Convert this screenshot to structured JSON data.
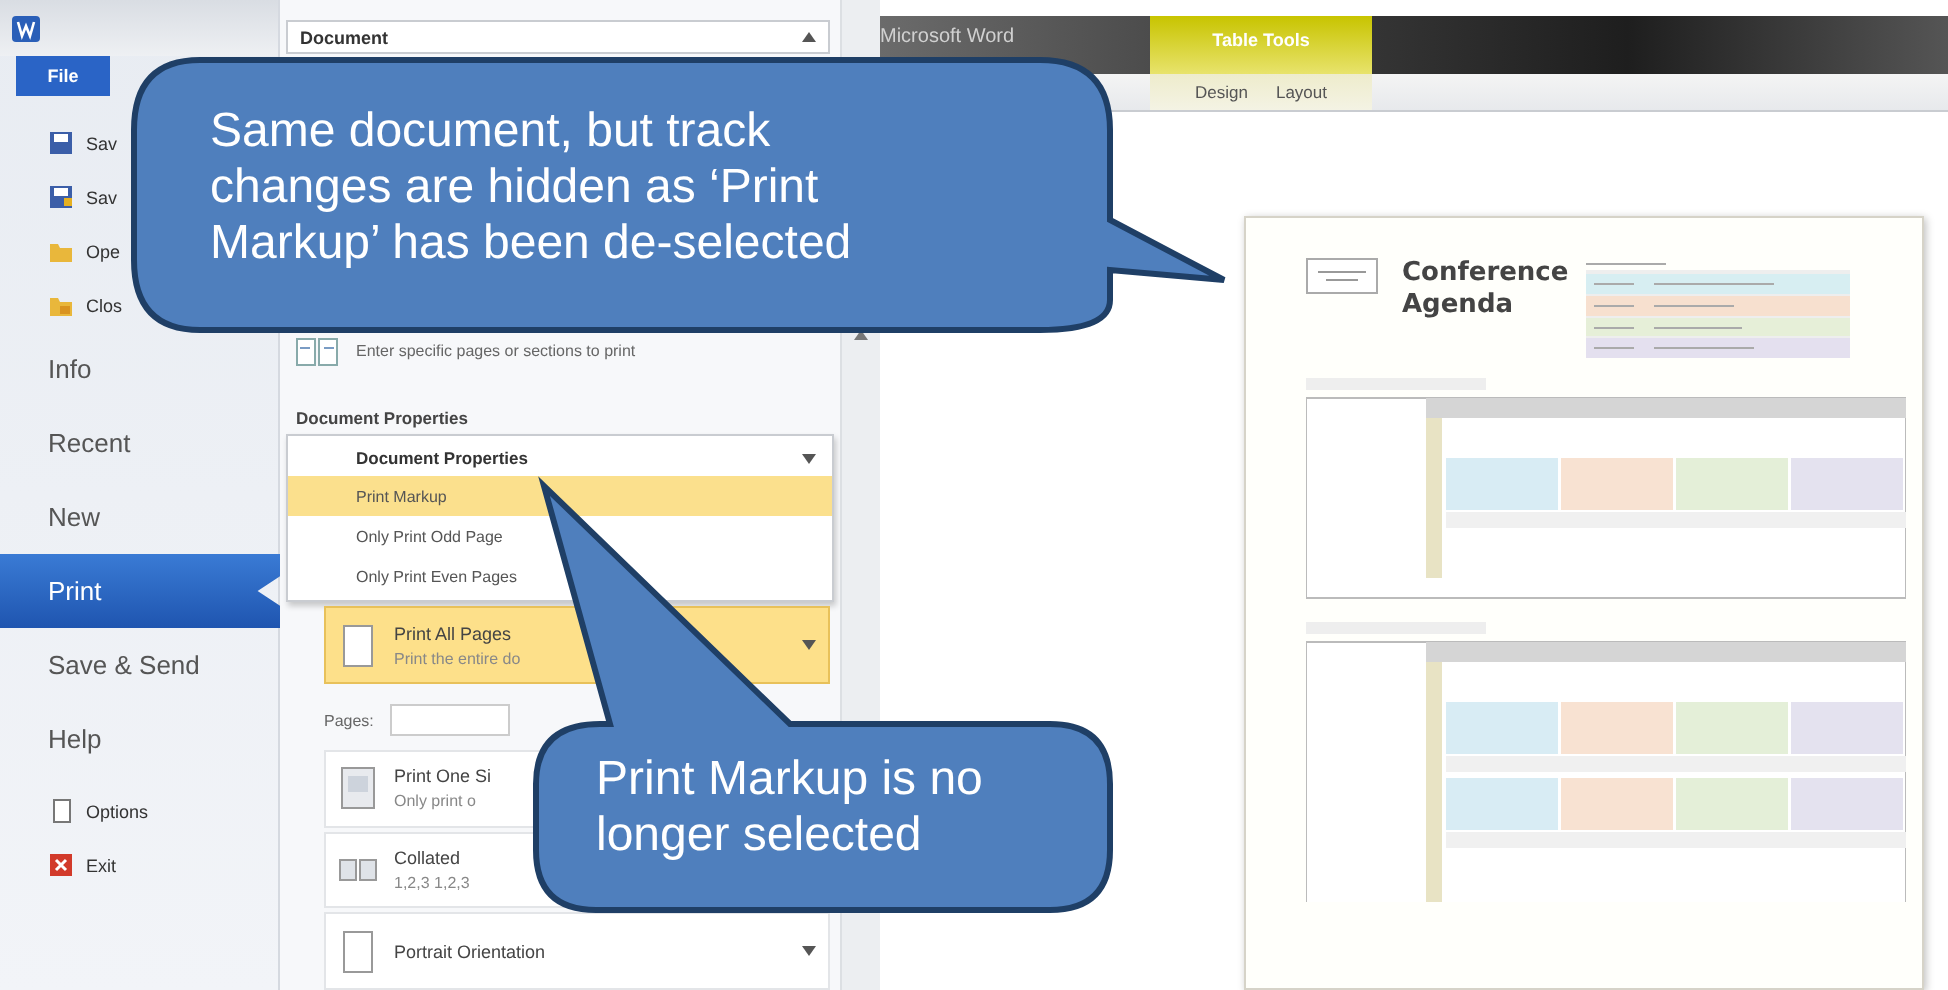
{
  "backstage_nav": {
    "file_tab": {
      "label": "File",
      "selected": true
    },
    "commands": [
      {
        "label": "Sav"
      },
      {
        "label": "Sav"
      },
      {
        "label": "Ope"
      },
      {
        "label": "Clos"
      }
    ],
    "pages": [
      {
        "label": "Info",
        "selected": false
      },
      {
        "label": "Recent",
        "selected": false
      },
      {
        "label": "New",
        "selected": false
      },
      {
        "label": "Print",
        "selected": true
      },
      {
        "label": "Save & Send",
        "selected": false
      },
      {
        "label": "Help",
        "selected": false
      }
    ],
    "footer_commands": [
      {
        "label": "Options"
      },
      {
        "label": "Exit"
      }
    ]
  },
  "print_settings": {
    "document_dropdown": {
      "value": "Document"
    },
    "custom_range": {
      "description": "Enter specific pages or sections to print"
    },
    "section_label": "Document Properties",
    "dropdown_menu": {
      "heading": "Document Properties",
      "items": [
        {
          "label": "Print Markup",
          "highlighted": true
        },
        {
          "label": "Only Print Odd Page",
          "highlighted": false
        },
        {
          "label": "Only Print Even Pages",
          "highlighted": false
        }
      ]
    },
    "settings": [
      {
        "kind": "dropdown",
        "title": "Print All Pages",
        "description": "Print the entire do",
        "highlighted": true
      },
      {
        "kind": "field",
        "label": "Pages:"
      },
      {
        "kind": "dropdown",
        "title": "Print One Si",
        "description": "Only print o",
        "highlighted": false
      },
      {
        "kind": "dropdown",
        "title": "Collated",
        "description": "1,2,3   1,2,3",
        "highlighted": false
      },
      {
        "kind": "dropdown",
        "title": "Portrait Orientation",
        "highlighted": false
      }
    ]
  },
  "title_bar": {
    "app_title": "Microsoft Word",
    "contextual_tab": "Table Tools",
    "ribbon_tabs": [
      {
        "label": "Design"
      },
      {
        "label": "Layout"
      }
    ]
  },
  "document_preview": {
    "title": "Conference Agenda"
  },
  "callouts": [
    {
      "text": "Same document, but track changes are hidden as ‘Print Markup’ has been de-selected"
    },
    {
      "text": "Print Markup is no longer selected"
    }
  ]
}
